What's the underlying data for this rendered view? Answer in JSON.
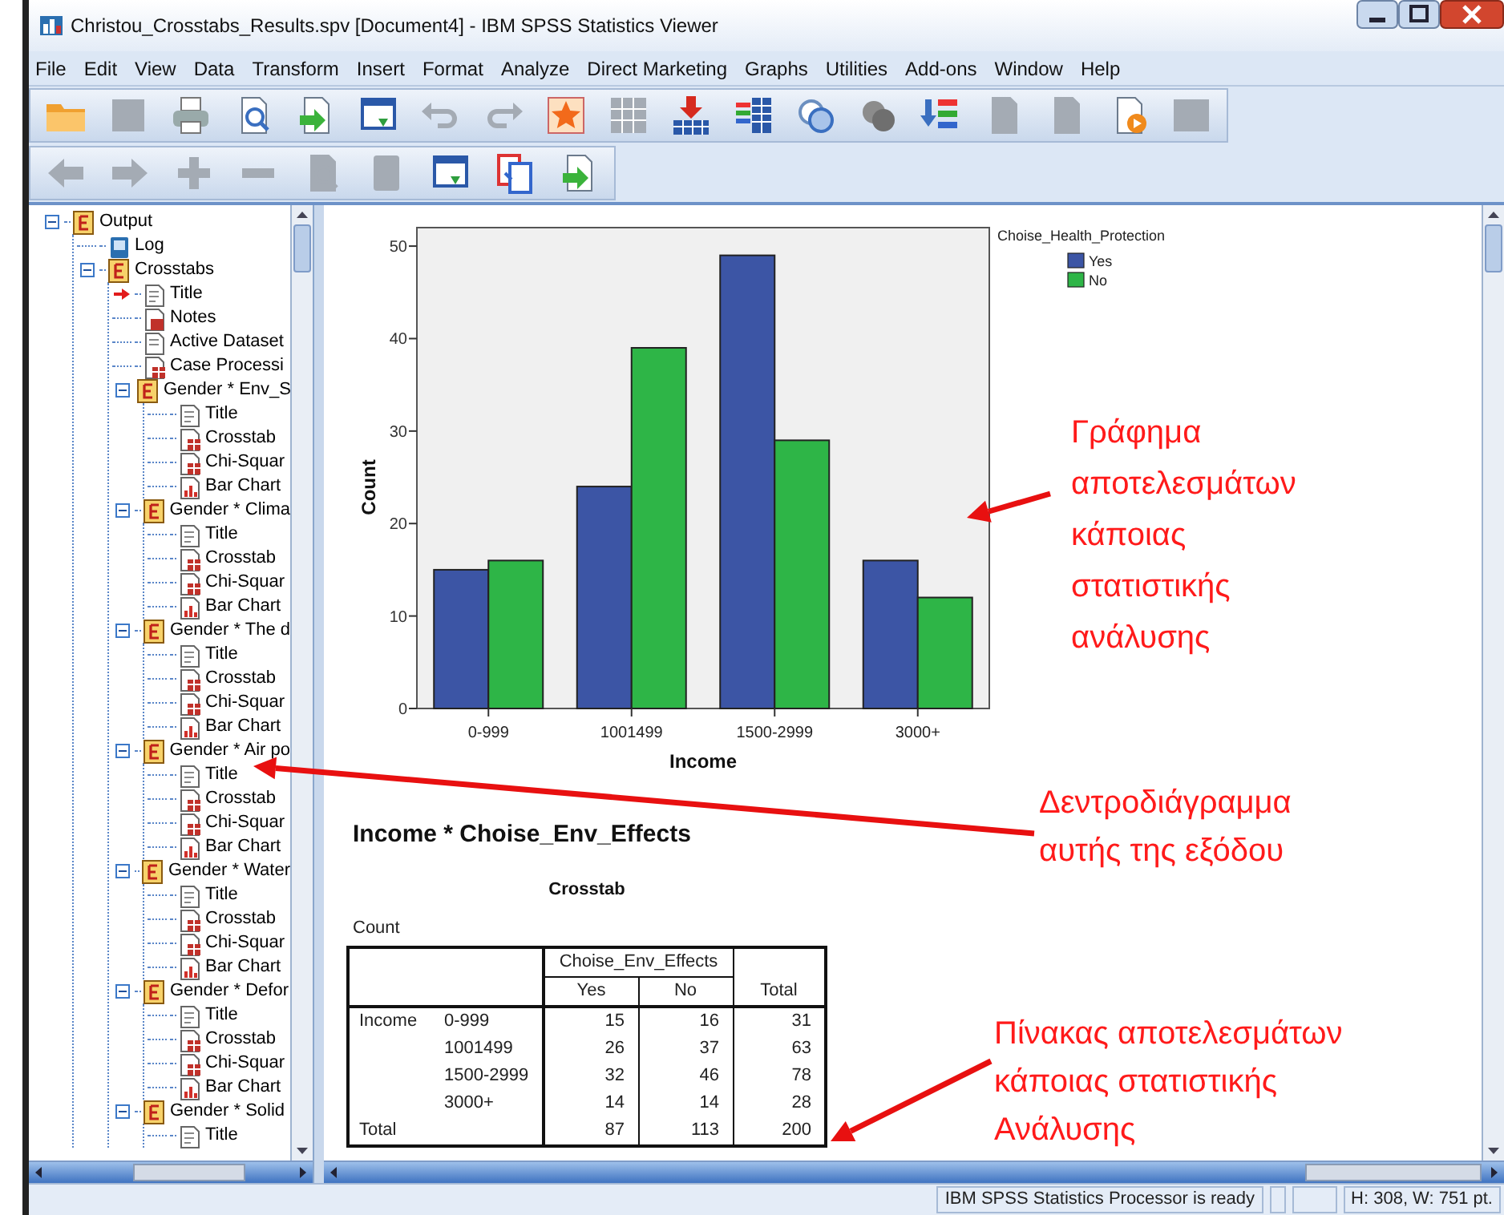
{
  "window": {
    "title": "Christou_Crosstabs_Results.spv [Document4] - IBM SPSS Statistics Viewer"
  },
  "menu": [
    "File",
    "Edit",
    "View",
    "Data",
    "Transform",
    "Insert",
    "Format",
    "Analyze",
    "Direct Marketing",
    "Graphs",
    "Utilities",
    "Add-ons",
    "Window",
    "Help"
  ],
  "toolbars": [
    [
      {
        "kind": "folder",
        "disabled": false
      },
      {
        "kind": "floppy",
        "disabled": true
      },
      {
        "kind": "printer",
        "disabled": false
      },
      {
        "kind": "page-magnifier",
        "disabled": false
      },
      {
        "kind": "page-arrow",
        "disabled": false
      },
      {
        "kind": "window",
        "disabled": false
      },
      {
        "kind": "undo",
        "disabled": true
      },
      {
        "kind": "redo",
        "disabled": true
      },
      {
        "kind": "star",
        "disabled": false
      },
      {
        "kind": "grid",
        "disabled": true
      },
      {
        "kind": "table-arrow",
        "disabled": false
      },
      {
        "kind": "table",
        "disabled": false
      },
      {
        "kind": "circles",
        "disabled": false
      },
      {
        "kind": "circles-solid",
        "disabled": false
      },
      {
        "kind": "list-arrow",
        "disabled": false
      },
      {
        "kind": "page",
        "disabled": true
      },
      {
        "kind": "page-pencil",
        "disabled": true
      },
      {
        "kind": "page-play",
        "disabled": false
      },
      {
        "kind": "frame",
        "disabled": true
      }
    ],
    [
      {
        "kind": "left-arrow",
        "disabled": true
      },
      {
        "kind": "right-arrow",
        "disabled": true
      },
      {
        "kind": "plus",
        "disabled": true
      },
      {
        "kind": "minus",
        "disabled": true
      },
      {
        "kind": "page-magnifier",
        "disabled": true
      },
      {
        "kind": "book",
        "disabled": true
      },
      {
        "kind": "window",
        "disabled": false
      },
      {
        "kind": "pages",
        "disabled": false
      },
      {
        "kind": "page-arrow",
        "disabled": false
      }
    ]
  ],
  "outline": {
    "items": [
      {
        "label": "Output",
        "kind": "folder",
        "expanded": true,
        "children": [
          {
            "label": "Log",
            "kind": "log",
            "current": false
          },
          {
            "label": "Crosstabs",
            "kind": "folder",
            "expanded": true,
            "children": [
              {
                "label": "Title",
                "kind": "title",
                "current": true
              },
              {
                "label": "Notes",
                "kind": "notes",
                "current": false
              },
              {
                "label": "Active Dataset",
                "kind": "dataset",
                "current": false
              },
              {
                "label": "Case Processi",
                "kind": "table",
                "current": false
              },
              {
                "label": "Gender * Env_S",
                "kind": "folder",
                "expanded": true,
                "children": [
                  {
                    "label": "Title",
                    "kind": "title",
                    "current": false
                  },
                  {
                    "label": "Crosstab",
                    "kind": "table",
                    "current": false
                  },
                  {
                    "label": "Chi-Squar",
                    "kind": "table",
                    "current": false
                  },
                  {
                    "label": "Bar Chart",
                    "kind": "chart",
                    "current": false
                  }
                ]
              },
              {
                "label": "Gender * Clima",
                "kind": "folder",
                "expanded": true,
                "children": [
                  {
                    "label": "Title",
                    "kind": "title",
                    "current": false
                  },
                  {
                    "label": "Crosstab",
                    "kind": "table",
                    "current": false
                  },
                  {
                    "label": "Chi-Squar",
                    "kind": "table",
                    "current": false
                  },
                  {
                    "label": "Bar Chart",
                    "kind": "chart",
                    "current": false
                  }
                ]
              },
              {
                "label": "Gender * The d",
                "kind": "folder",
                "expanded": true,
                "children": [
                  {
                    "label": "Title",
                    "kind": "title",
                    "current": false
                  },
                  {
                    "label": "Crosstab",
                    "kind": "table",
                    "current": false
                  },
                  {
                    "label": "Chi-Squar",
                    "kind": "table",
                    "current": false
                  },
                  {
                    "label": "Bar Chart",
                    "kind": "chart",
                    "current": false
                  }
                ]
              },
              {
                "label": "Gender * Air po",
                "kind": "folder",
                "expanded": true,
                "children": [
                  {
                    "label": "Title",
                    "kind": "title",
                    "current": false
                  },
                  {
                    "label": "Crosstab",
                    "kind": "table",
                    "current": false
                  },
                  {
                    "label": "Chi-Squar",
                    "kind": "table",
                    "current": false
                  },
                  {
                    "label": "Bar Chart",
                    "kind": "chart",
                    "current": false
                  }
                ]
              },
              {
                "label": "Gender * Water",
                "kind": "folder",
                "expanded": true,
                "children": [
                  {
                    "label": "Title",
                    "kind": "title",
                    "current": false
                  },
                  {
                    "label": "Crosstab",
                    "kind": "table",
                    "current": false
                  },
                  {
                    "label": "Chi-Squar",
                    "kind": "table",
                    "current": false
                  },
                  {
                    "label": "Bar Chart",
                    "kind": "chart",
                    "current": false
                  }
                ]
              },
              {
                "label": "Gender * Defor",
                "kind": "folder",
                "expanded": true,
                "children": [
                  {
                    "label": "Title",
                    "kind": "title",
                    "current": false
                  },
                  {
                    "label": "Crosstab",
                    "kind": "table",
                    "current": false
                  },
                  {
                    "label": "Chi-Squar",
                    "kind": "table",
                    "current": false
                  },
                  {
                    "label": "Bar Chart",
                    "kind": "chart",
                    "current": false
                  }
                ]
              },
              {
                "label": "Gender * Solid",
                "kind": "folder",
                "expanded": true,
                "children": [
                  {
                    "label": "Title",
                    "kind": "title",
                    "current": false
                  }
                ]
              }
            ]
          }
        ]
      }
    ]
  },
  "content": {
    "chart": {
      "chart_data": {
        "type": "bar",
        "legend": {
          "title": "Choise_Health_Protection"
        },
        "xlabel": "Income",
        "ylabel": "Count",
        "categories": [
          "0-999",
          "1001499",
          "1500-2999",
          "3000+"
        ],
        "series": [
          {
            "name": "Yes",
            "color": "#3c55a5",
            "values": [
              15,
              24,
              49,
              16
            ]
          },
          {
            "name": "No",
            "color": "#2eb547",
            "values": [
              16,
              39,
              29,
              12
            ]
          }
        ],
        "ylim": [
          0,
          52
        ],
        "yticks": [
          0,
          10,
          20,
          30,
          40,
          50
        ]
      }
    },
    "heading": "Income * Choise_Env_Effects",
    "table": {
      "title": "Crosstab",
      "caption": "Count",
      "column_group": "Choise_Env_Effects",
      "columns": [
        "Yes",
        "No",
        "Total"
      ],
      "rows": [
        {
          "group": "Income",
          "label": "0-999",
          "values": [
            "15",
            "16",
            "31"
          ]
        },
        {
          "label": "1001499",
          "values": [
            "26",
            "37",
            "63"
          ]
        },
        {
          "label": "1500-2999",
          "values": [
            "32",
            "46",
            "78"
          ]
        },
        {
          "label": "3000+",
          "values": [
            "14",
            "14",
            "28"
          ]
        },
        {
          "group": "Total",
          "values": [
            "87",
            "113",
            "200"
          ]
        }
      ]
    }
  },
  "annotations": [
    {
      "text": "Γράφημα\nαποτελεσμάτων\nκάποιας\nστατιστικής\nανάλυσης"
    },
    {
      "text": "Δεντροδιάγραμμα\nαυτής της εξόδου"
    },
    {
      "text": "Πίνακας αποτελεσμάτων\nκάποιας στατιστικής\nΑνάλυσης"
    }
  ],
  "status_bar": {
    "message": "IBM SPSS Statistics Processor is ready",
    "size": "H: 308, W: 751 pt."
  }
}
